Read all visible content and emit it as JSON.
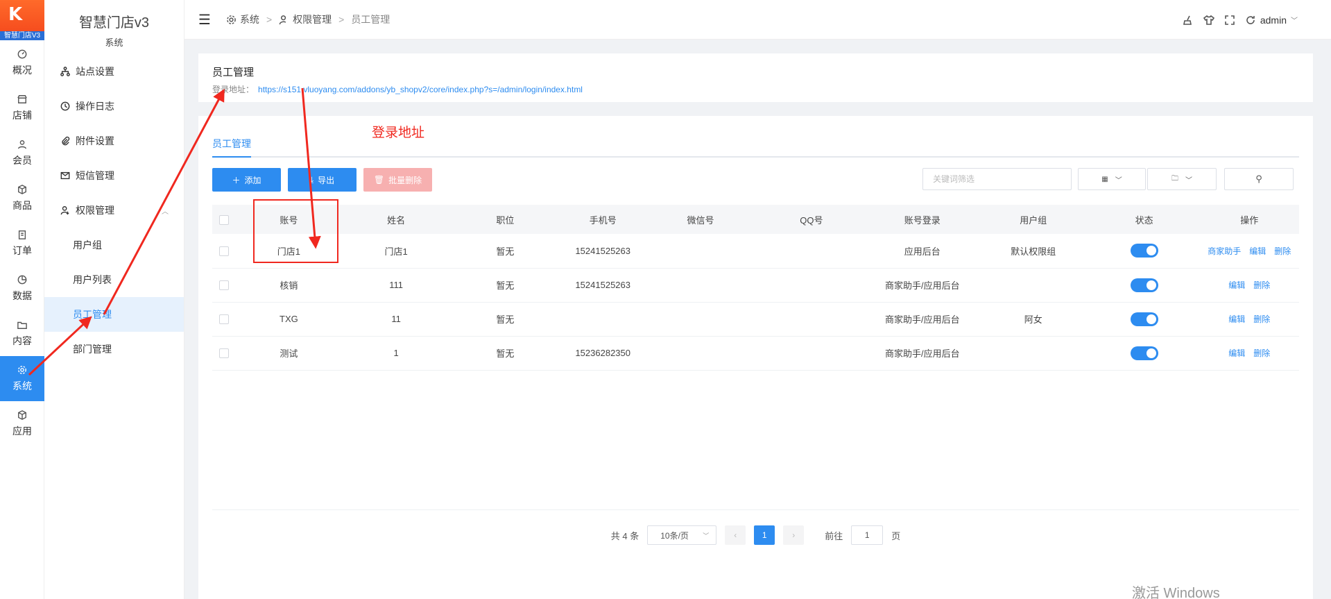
{
  "logo": {
    "mark": "K",
    "sub": "智慧门店V3"
  },
  "rail": [
    {
      "label": "概况",
      "icon": "dashboard-icon"
    },
    {
      "label": "店铺",
      "icon": "store-icon"
    },
    {
      "label": "会员",
      "icon": "user-icon"
    },
    {
      "label": "商品",
      "icon": "box-icon"
    },
    {
      "label": "订单",
      "icon": "order-icon"
    },
    {
      "label": "数据",
      "icon": "chart-icon"
    },
    {
      "label": "内容",
      "icon": "folder-icon"
    },
    {
      "label": "系统",
      "icon": "gear-icon",
      "active": true
    },
    {
      "label": "应用",
      "icon": "package-icon"
    }
  ],
  "sidebar": {
    "title": "智慧门店v3",
    "subtitle": "系统",
    "items": [
      {
        "label": "站点设置",
        "icon": "sitemap-icon"
      },
      {
        "label": "操作日志",
        "icon": "history-icon"
      },
      {
        "label": "附件设置",
        "icon": "paperclip-icon"
      },
      {
        "label": "短信管理",
        "icon": "mail-icon"
      },
      {
        "label": "权限管理",
        "icon": "user-key-icon",
        "expanded": true
      }
    ],
    "subitems": [
      {
        "label": "用户组"
      },
      {
        "label": "用户列表"
      },
      {
        "label": "员工管理",
        "active": true
      },
      {
        "label": "部门管理"
      }
    ]
  },
  "topbar": {
    "breadcrumb": [
      "系统",
      "权限管理",
      "员工管理"
    ],
    "user": "admin"
  },
  "page": {
    "title": "员工管理",
    "login_label": "登录地址：",
    "login_url": "https://s151.vluoyang.com/addons/yb_shopv2/core/index.php?s=/admin/login/index.html"
  },
  "tab": "员工管理",
  "toolbar": {
    "add": "添加",
    "export": "导出",
    "batch_delete": "批量删除",
    "search_placeholder": "关键词筛选"
  },
  "table": {
    "headers": [
      "账号",
      "姓名",
      "职位",
      "手机号",
      "微信号",
      "QQ号",
      "账号登录",
      "用户组",
      "状态",
      "操作"
    ],
    "rows": [
      {
        "account": "门店1",
        "name": "门店1",
        "position": "暂无",
        "phone": "15241525263",
        "wechat": "",
        "qq": "",
        "login": "应用后台",
        "group": "默认权限组",
        "ops": [
          "商家助手",
          "编辑",
          "删除"
        ]
      },
      {
        "account": "核销",
        "name": "111",
        "position": "暂无",
        "phone": "15241525263",
        "wechat": "",
        "qq": "",
        "login": "商家助手/应用后台",
        "group": "",
        "ops": [
          "编辑",
          "删除"
        ]
      },
      {
        "account": "TXG",
        "name": "11",
        "position": "暂无",
        "phone": "",
        "wechat": "",
        "qq": "",
        "login": "商家助手/应用后台",
        "group": "阿女",
        "ops": [
          "编辑",
          "删除"
        ]
      },
      {
        "account": "测试",
        "name": "1",
        "position": "暂无",
        "phone": "15236282350",
        "wechat": "",
        "qq": "",
        "login": "商家助手/应用后台",
        "group": "",
        "ops": [
          "编辑",
          "删除"
        ]
      }
    ]
  },
  "pagination": {
    "total": "共 4 条",
    "page_size": "10条/页",
    "current": "1",
    "goto_label": "前往",
    "goto_value": "1",
    "page_label": "页"
  },
  "annotation": {
    "text": "登录地址"
  },
  "watermark": "激活 Windows",
  "colors": {
    "primary": "#2d8cf0",
    "annotation": "#f0281f",
    "danger_light": "#f7b0b0"
  }
}
